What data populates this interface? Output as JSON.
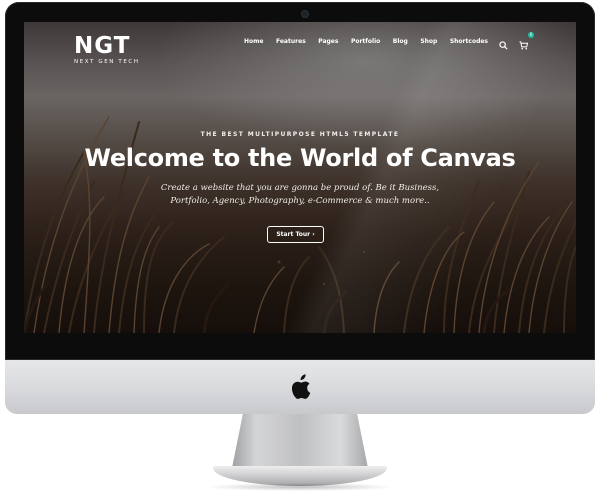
{
  "logo": {
    "mark": "NGT",
    "subtitle": "NEXT GEN TECH"
  },
  "nav": {
    "items": [
      "Home",
      "Features",
      "Pages",
      "Portfolio",
      "Blog",
      "Shop",
      "Shortcodes"
    ],
    "cart_count": "0"
  },
  "hero": {
    "tagline": "THE BEST MULTIPURPOSE HTML5 TEMPLATE",
    "headline": "Welcome to the World of Canvas",
    "subtext": "Create a website that you are gonna be proud of. Be it Business, Portfolio, Agency, Photography, e-Commerce & much more..",
    "cta_label": "Start Tour ›"
  },
  "icons": [
    "search-icon",
    "cart-icon",
    "apple-logo-icon"
  ],
  "colors": {
    "cart_badge": "#1abc9c",
    "bezel": "#0c0c0c",
    "chin": "#d8d9dc"
  }
}
